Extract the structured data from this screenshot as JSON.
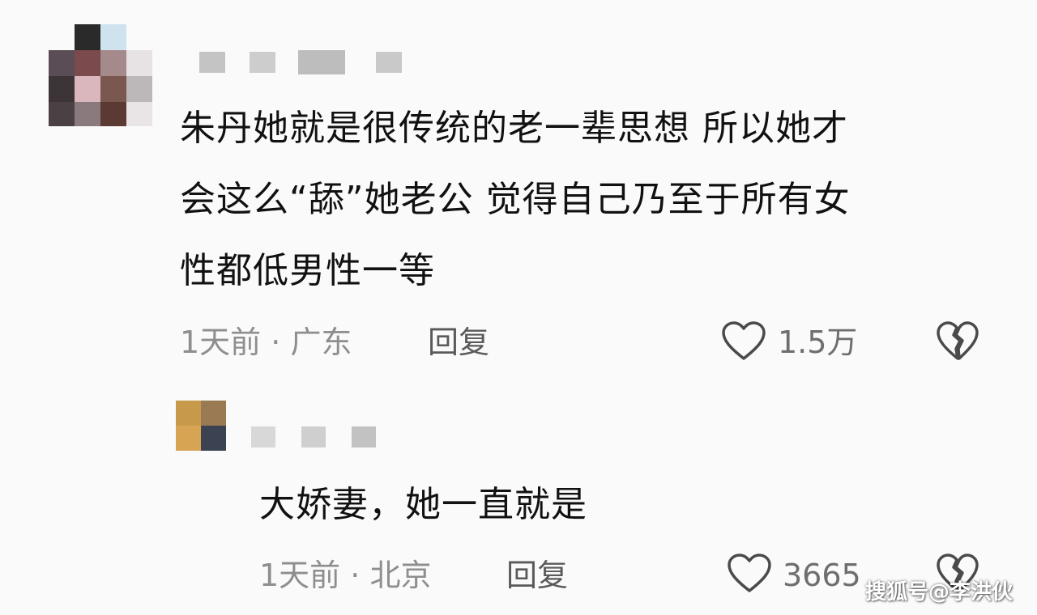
{
  "comments": [
    {
      "text_lines": [
        "朱丹她就是很传统的老一辈思想 所以她才",
        "会这么“舔”她老公 觉得自己乃至于所有女",
        "性都低男性一等"
      ],
      "time": "1天前",
      "separator": "·",
      "location": "广东",
      "reply_label": "回复",
      "likes": "1.5万"
    },
    {
      "text_lines": [
        "大娇妻，她一直就是"
      ],
      "time": "1天前",
      "separator": "·",
      "location": "北京",
      "reply_label": "回复",
      "likes": "3665"
    }
  ],
  "icons": {
    "like": "heart-outline-icon",
    "dislike": "broken-heart-icon"
  },
  "watermark": "搜狐号@李洪伙"
}
